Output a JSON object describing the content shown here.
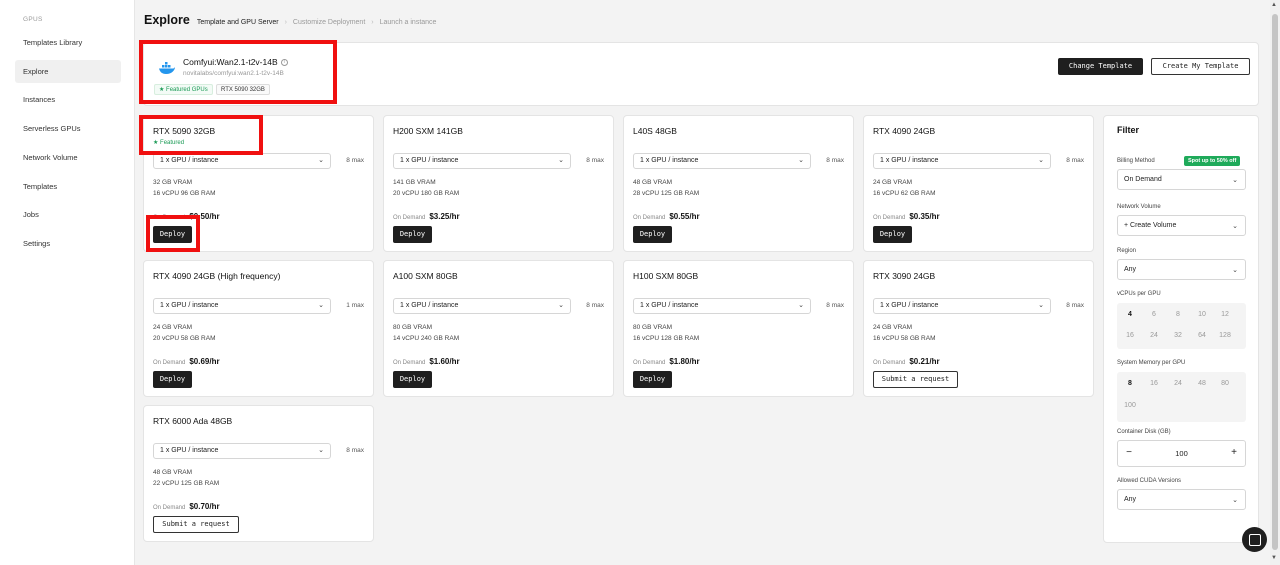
{
  "sidebar": {
    "group": "GPUS",
    "items": [
      {
        "label": "Templates Library",
        "active": false
      },
      {
        "label": "Explore",
        "active": true
      },
      {
        "label": "Instances",
        "active": false
      },
      {
        "label": "Serverless GPUs",
        "active": false
      },
      {
        "label": "Network Volume",
        "active": false
      },
      {
        "label": "Templates",
        "active": false
      },
      {
        "label": "Jobs",
        "active": false
      },
      {
        "label": "Settings",
        "active": false
      }
    ]
  },
  "header": {
    "title": "Explore",
    "crumbs": [
      "Template and GPU Server",
      "Customize Deployment",
      "Launch a instance"
    ]
  },
  "template": {
    "name": "Comfyui:Wan2.1-t2v-14B",
    "path": "novitalabs/comfyui:wan2.1-t2v-14B",
    "tag_featured": "Featured GPUs",
    "tag_gpu": "RTX 5090 32GB",
    "change_label": "Change Template",
    "create_label": "Create My Template"
  },
  "labels": {
    "on_demand": "On Demand",
    "deploy": "Deploy",
    "submit": "Submit a request",
    "featured": "Featured",
    "gpu_select": "1 x GPU / instance"
  },
  "gpus": [
    {
      "name": "RTX 5090 32GB",
      "featured": true,
      "max": "8 max",
      "vram": "32 GB VRAM",
      "cpu": "16 vCPU 96 GB RAM",
      "price": "$0.50/hr",
      "action": "deploy"
    },
    {
      "name": "H200 SXM 141GB",
      "max": "8 max",
      "vram": "141 GB VRAM",
      "cpu": "20 vCPU 180 GB RAM",
      "price": "$3.25/hr",
      "action": "deploy"
    },
    {
      "name": "L40S 48GB",
      "max": "8 max",
      "vram": "48 GB VRAM",
      "cpu": "28 vCPU 125 GB RAM",
      "price": "$0.55/hr",
      "action": "deploy"
    },
    {
      "name": "RTX 4090 24GB",
      "max": "8 max",
      "vram": "24 GB VRAM",
      "cpu": "16 vCPU 62 GB RAM",
      "price": "$0.35/hr",
      "action": "deploy"
    },
    {
      "name": "RTX 4090 24GB (High frequency)",
      "max": "1 max",
      "vram": "24 GB VRAM",
      "cpu": "20 vCPU 58 GB RAM",
      "price": "$0.69/hr",
      "action": "deploy"
    },
    {
      "name": "A100 SXM 80GB",
      "max": "8 max",
      "vram": "80 GB VRAM",
      "cpu": "14 vCPU 240 GB RAM",
      "price": "$1.60/hr",
      "action": "deploy"
    },
    {
      "name": "H100 SXM 80GB",
      "max": "8 max",
      "vram": "80 GB VRAM",
      "cpu": "16 vCPU 128 GB RAM",
      "price": "$1.80/hr",
      "action": "deploy"
    },
    {
      "name": "RTX 3090 24GB",
      "max": "8 max",
      "vram": "24 GB VRAM",
      "cpu": "16 vCPU 58 GB RAM",
      "price": "$0.21/hr",
      "action": "submit"
    },
    {
      "name": "RTX 6000 Ada 48GB",
      "max": "8 max",
      "vram": "48 GB VRAM",
      "cpu": "22 vCPU 125 GB RAM",
      "price": "$0.70/hr",
      "action": "submit"
    }
  ],
  "filter": {
    "title": "Filter",
    "billing_label": "Billing Method",
    "promo": "Spot up to 50% off",
    "billing_value": "On Demand",
    "volume_label": "Network Volume",
    "volume_value": "+ Create Volume",
    "region_label": "Region",
    "region_value": "Any",
    "vcpu_label": "vCPUs per GPU",
    "vcpu_options": [
      "4",
      "6",
      "8",
      "10",
      "12",
      "16",
      "24",
      "32",
      "64",
      "128"
    ],
    "vcpu_selected": "4",
    "mem_label": "System Memory per GPU",
    "mem_options": [
      "8",
      "16",
      "24",
      "48",
      "80",
      "100"
    ],
    "mem_selected": "8",
    "disk_label": "Container Disk (GB)",
    "disk_value": "100",
    "cuda_label": "Allowed CUDA Versions",
    "cuda_value": "Any"
  },
  "colors": {
    "accent_dark": "#1f1f1f",
    "featured_green": "#1a9a55",
    "highlight_red": "#f01010"
  }
}
